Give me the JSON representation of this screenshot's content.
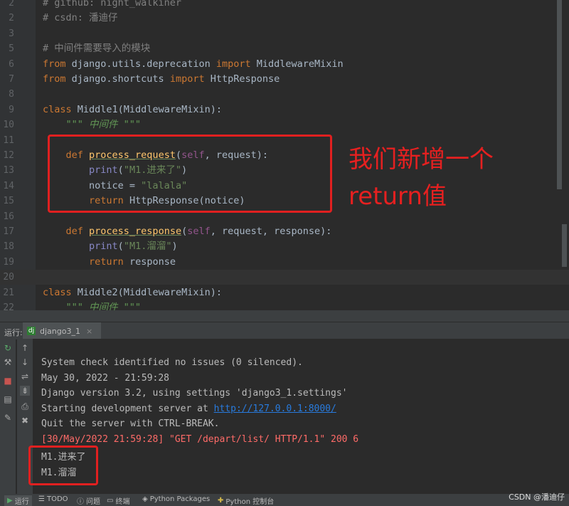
{
  "editor": {
    "lines": [
      {
        "n": "2",
        "tokens": [
          {
            "t": "# github: night_walkiner",
            "c": "cm"
          }
        ]
      },
      {
        "n": "2",
        "tokens": [
          {
            "t": "# csdn: 潘迪仔",
            "c": "cm"
          }
        ]
      },
      {
        "n": "3",
        "tokens": []
      },
      {
        "n": "5",
        "tokens": [
          {
            "t": "# 中间件需要导入的模块",
            "c": "cm"
          }
        ]
      },
      {
        "n": "6",
        "tokens": [
          {
            "t": "from ",
            "c": "kw"
          },
          {
            "t": "django.utils.deprecation ",
            "c": "cn"
          },
          {
            "t": "import ",
            "c": "kw"
          },
          {
            "t": "MiddlewareMixin",
            "c": "cn"
          }
        ]
      },
      {
        "n": "7",
        "tokens": [
          {
            "t": "from ",
            "c": "kw"
          },
          {
            "t": "django.shortcuts ",
            "c": "cn"
          },
          {
            "t": "import ",
            "c": "kw"
          },
          {
            "t": "HttpResponse",
            "c": "cn"
          }
        ]
      },
      {
        "n": "8",
        "tokens": []
      },
      {
        "n": "9",
        "tokens": [
          {
            "t": "class ",
            "c": "kw"
          },
          {
            "t": "Middle1(MiddlewareMixin):",
            "c": "cn"
          }
        ]
      },
      {
        "n": "10",
        "tokens": [
          {
            "t": "    ",
            "c": "cn"
          },
          {
            "t": "\"\"\" 中间件 \"\"\"",
            "c": "doc"
          }
        ]
      },
      {
        "n": "11",
        "tokens": []
      },
      {
        "n": "12",
        "tokens": [
          {
            "t": "    ",
            "c": "cn"
          },
          {
            "t": "def ",
            "c": "kw"
          },
          {
            "t": "process_request",
            "c": "fn"
          },
          {
            "t": "(",
            "c": "cn"
          },
          {
            "t": "self",
            "c": "self"
          },
          {
            "t": ", request):",
            "c": "param"
          }
        ]
      },
      {
        "n": "13",
        "tokens": [
          {
            "t": "        ",
            "c": "cn"
          },
          {
            "t": "print",
            "c": "builtin"
          },
          {
            "t": "(",
            "c": "cn"
          },
          {
            "t": "\"M1.进来了\"",
            "c": "str"
          },
          {
            "t": ")",
            "c": "cn"
          }
        ]
      },
      {
        "n": "14",
        "tokens": [
          {
            "t": "        notice = ",
            "c": "cn"
          },
          {
            "t": "\"lalala\"",
            "c": "str"
          }
        ]
      },
      {
        "n": "15",
        "tokens": [
          {
            "t": "        ",
            "c": "cn"
          },
          {
            "t": "return ",
            "c": "kw"
          },
          {
            "t": "HttpResponse(notice)",
            "c": "cn"
          }
        ]
      },
      {
        "n": "16",
        "tokens": []
      },
      {
        "n": "17",
        "tokens": [
          {
            "t": "    ",
            "c": "cn"
          },
          {
            "t": "def ",
            "c": "kw"
          },
          {
            "t": "process_response",
            "c": "fn"
          },
          {
            "t": "(",
            "c": "cn"
          },
          {
            "t": "self",
            "c": "self"
          },
          {
            "t": ", request, response):",
            "c": "param"
          }
        ]
      },
      {
        "n": "18",
        "tokens": [
          {
            "t": "        ",
            "c": "cn"
          },
          {
            "t": "print",
            "c": "builtin"
          },
          {
            "t": "(",
            "c": "cn"
          },
          {
            "t": "\"M1.溜溜\"",
            "c": "str"
          },
          {
            "t": ")",
            "c": "cn"
          }
        ]
      },
      {
        "n": "19",
        "tokens": [
          {
            "t": "        ",
            "c": "cn"
          },
          {
            "t": "return ",
            "c": "kw"
          },
          {
            "t": "response",
            "c": "cn"
          }
        ]
      },
      {
        "n": "20",
        "tokens": [],
        "current": true
      },
      {
        "n": "21",
        "tokens": [
          {
            "t": "class ",
            "c": "kw"
          },
          {
            "t": "Middle2(MiddlewareMixin):",
            "c": "cn"
          }
        ]
      },
      {
        "n": "22",
        "tokens": [
          {
            "t": "    ",
            "c": "cn"
          },
          {
            "t": "\"\"\" 中间件 \"\"\"",
            "c": "doc"
          }
        ]
      }
    ]
  },
  "annotation": {
    "line1": "我们新增一个",
    "line2": "return值",
    "color": "#e62020"
  },
  "run_panel": {
    "label": "运行:",
    "tab_label": "django3_1",
    "console_lines": [
      {
        "text": "System check identified no issues (0 silenced).",
        "type": "normal"
      },
      {
        "text": "May 30, 2022 - 21:59:28",
        "type": "normal"
      },
      {
        "text": "Django version 3.2, using settings 'django3_1.settings'",
        "type": "normal"
      },
      {
        "prefix": "Starting development server at ",
        "link": "http://127.0.0.1:8000/",
        "type": "link"
      },
      {
        "text": "Quit the server with CTRL-BREAK.",
        "type": "normal"
      },
      {
        "text": "[30/May/2022 21:59:28] \"GET /depart/list/ HTTP/1.1\" 200 6",
        "type": "err"
      },
      {
        "text": "M1.进来了",
        "type": "normal"
      },
      {
        "text": "M1.溜溜",
        "type": "normal"
      }
    ]
  },
  "statusbar": {
    "run": "运行",
    "todo": "TODO",
    "problems": "问题",
    "terminal": "终端",
    "packages": "Python Packages",
    "console": "Python 控制台",
    "watermark": "CSDN @潘迪仔"
  }
}
